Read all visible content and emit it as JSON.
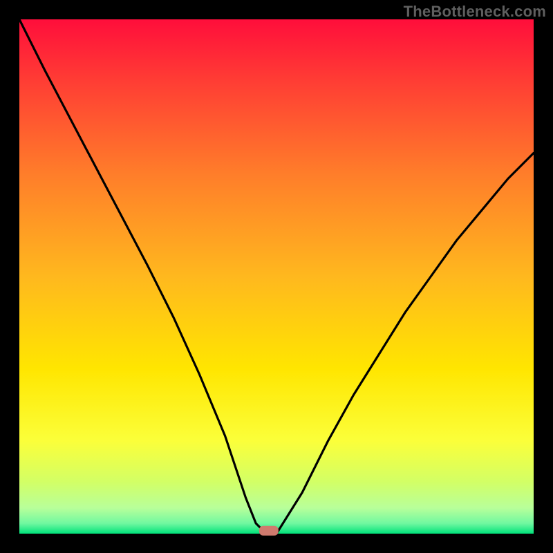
{
  "watermark": "TheBottleneck.com",
  "chart_data": {
    "type": "line",
    "title": "",
    "xlabel": "",
    "ylabel": "",
    "xlim": [
      0,
      100
    ],
    "ylim": [
      0,
      100
    ],
    "x": [
      0,
      5,
      10,
      15,
      20,
      25,
      30,
      35,
      40,
      42,
      44,
      46,
      48,
      50,
      55,
      60,
      65,
      70,
      75,
      80,
      85,
      90,
      95,
      100
    ],
    "values": [
      100,
      90,
      80.5,
      71,
      61.5,
      52,
      42,
      31,
      19,
      13,
      7,
      2,
      0,
      0,
      8,
      18,
      27,
      35,
      43,
      50,
      57,
      63,
      69,
      74
    ],
    "marker": {
      "x": 48.5,
      "y": 0.3
    },
    "colors": {
      "gradient_top": "#ff0e3b",
      "gradient_mid": "#ffe600",
      "gradient_low": "#d2ff66",
      "gradient_bottom": "#00e27a",
      "curve": "#000000",
      "marker": "#cf7a6e"
    }
  }
}
